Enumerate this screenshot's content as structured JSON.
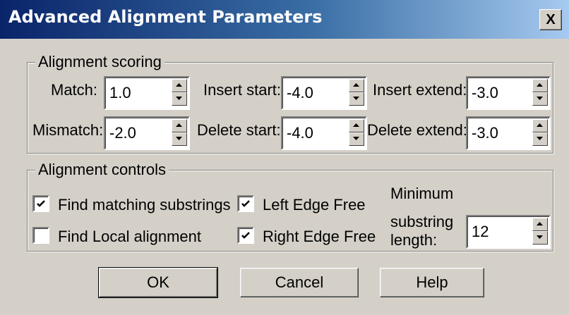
{
  "window": {
    "title": "Advanced Alignment Parameters",
    "close_label": "X"
  },
  "scoring": {
    "legend": "Alignment scoring",
    "match": {
      "label": "Match:",
      "value": "1.0"
    },
    "mismatch": {
      "label": "Mismatch:",
      "value": "-2.0"
    },
    "insert_start": {
      "label": "Insert start:",
      "value": "-4.0"
    },
    "delete_start": {
      "label": "Delete start:",
      "value": "-4.0"
    },
    "insert_extend": {
      "label": "Insert extend:",
      "value": "-3.0"
    },
    "delete_extend": {
      "label": "Delete extend:",
      "value": "-3.0"
    }
  },
  "controls": {
    "legend": "Alignment controls",
    "find_matching": {
      "label": "Find matching substrings",
      "checked": true
    },
    "find_local": {
      "label": "Find Local alignment",
      "checked": false
    },
    "left_edge": {
      "label": "Left Edge Free",
      "checked": true
    },
    "right_edge": {
      "label": "Right Edge Free",
      "checked": true
    },
    "min_substring": {
      "label_line1": "Minimum",
      "label_line2": "substring",
      "label_line3": "length:",
      "value": "12"
    }
  },
  "buttons": {
    "ok": "OK",
    "cancel": "Cancel",
    "help": "Help"
  }
}
